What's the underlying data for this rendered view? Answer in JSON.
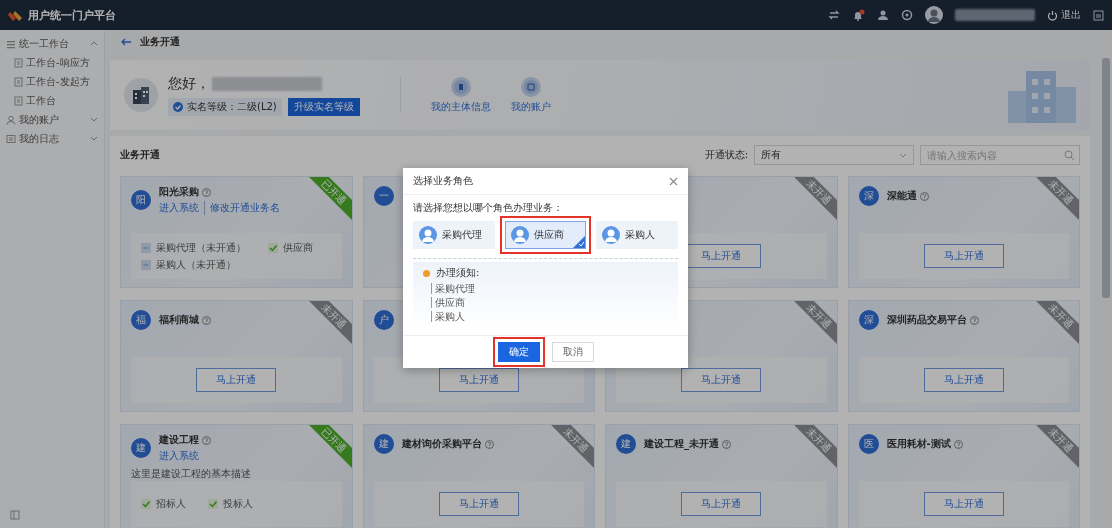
{
  "header": {
    "title": "用户统一门户平台",
    "logout": "退出"
  },
  "sidebar": {
    "items": [
      {
        "label": "统一工作台",
        "expanded": true,
        "children": [
          {
            "label": "工作台-响应方"
          },
          {
            "label": "工作台-发起方"
          },
          {
            "label": "工作台"
          }
        ]
      },
      {
        "label": "我的账户",
        "expanded": false
      },
      {
        "label": "我的日志",
        "expanded": false
      }
    ]
  },
  "breadcrumb": {
    "title": "业务开通"
  },
  "welcome": {
    "greeting": "您好，",
    "verify_level": "实名等级：二级(L2)",
    "upgrade_button": "升级实名等级",
    "shortcuts": [
      "我的主体信息",
      "我的账户"
    ]
  },
  "section": {
    "title": "业务开通",
    "filter_label": "开通状态:",
    "filter_value": "所有",
    "search_placeholder": "请输入搜索内容"
  },
  "cards": [
    {
      "avatar": "阳",
      "title": "阳光采购",
      "links": [
        "进入系统",
        "修改开通业务名"
      ],
      "status": "已开通",
      "opened": true,
      "roles": [
        {
          "label": "采购代理（未开通）",
          "checked": false
        },
        {
          "label": "供应商",
          "checked": true
        },
        {
          "label": "采购人（未开通）",
          "checked": false
        }
      ]
    },
    {
      "avatar": "一"
    },
    {
      "status": "未开通",
      "opened": false,
      "button": "马上开通"
    },
    {
      "avatar": "深",
      "title": "深能通",
      "status": "未开通",
      "opened": false,
      "button": "马上开通"
    },
    {
      "avatar": "福",
      "title": "福利商城",
      "status": "未开通",
      "opened": false,
      "button": "马上开通"
    },
    {
      "avatar": "户",
      "button": "马上开通"
    },
    {
      "status": "未开通",
      "opened": false,
      "button": "马上开通"
    },
    {
      "avatar": "深",
      "title": "深圳药品交易平台",
      "status": "未开通",
      "opened": false,
      "button": "马上开通"
    },
    {
      "avatar": "建",
      "title": "建设工程",
      "links": [
        "进入系统"
      ],
      "description": "这里是建设工程的基本描述",
      "status": "已开通",
      "opened": true,
      "roles": [
        {
          "label": "招标人",
          "checked": true
        },
        {
          "label": "投标人",
          "checked": true
        }
      ]
    },
    {
      "avatar": "建",
      "title": "建材询价采购平台",
      "status": "未开通",
      "opened": false,
      "button": "马上开通"
    },
    {
      "avatar": "建",
      "title": "建设工程_未开通",
      "status": "未开通",
      "opened": false,
      "button": "马上开通"
    },
    {
      "avatar": "医",
      "title": "医用耗材-测试",
      "status": "未开通",
      "opened": false,
      "button": "马上开通"
    }
  ],
  "modal": {
    "title": "选择业务角色",
    "prompt": "请选择您想以哪个角色办理业务：",
    "roles": [
      {
        "label": "采购代理",
        "selected": false,
        "highlighted": false
      },
      {
        "label": "供应商",
        "selected": true,
        "highlighted": true
      },
      {
        "label": "采购人",
        "selected": false,
        "highlighted": false
      }
    ],
    "notice_title": "办理须知:",
    "notice_items": [
      "采购代理",
      "供应商",
      "采购人"
    ],
    "buttons": [
      {
        "label": "确定",
        "kind": "primary",
        "highlighted": true
      },
      {
        "label": "取消",
        "kind": "default",
        "highlighted": false
      }
    ]
  }
}
